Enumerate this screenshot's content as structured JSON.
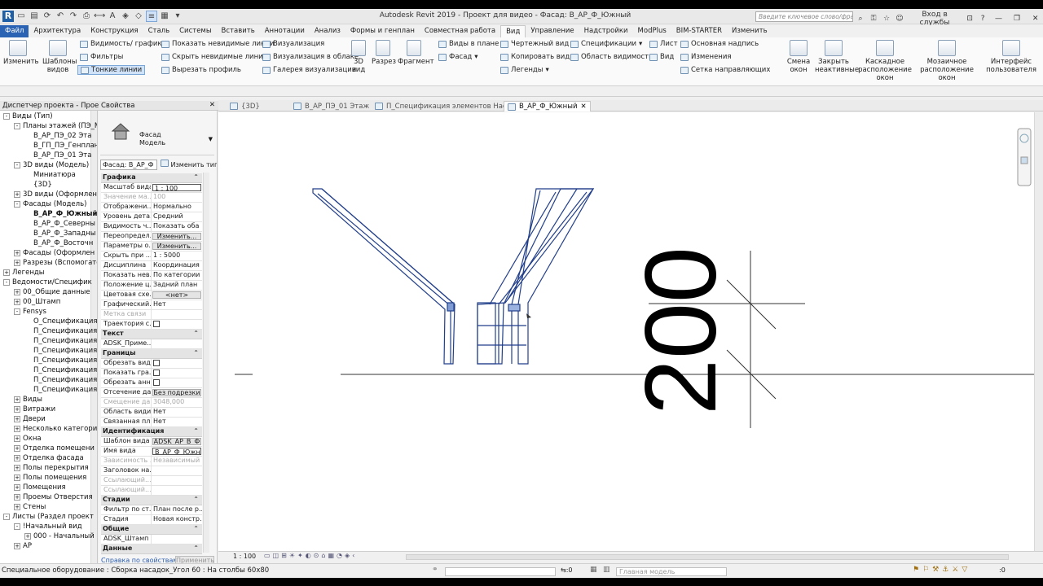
{
  "titlebar": {
    "title": "Autodesk Revit 2019 - Проект для видео - Фасад: В_АР_Ф_Южный",
    "search_placeholder": "Введите ключевое слово/фразу",
    "login": "Вход в службы",
    "logo": "R"
  },
  "menu": [
    "Файл",
    "Архитектура",
    "Конструкция",
    "Сталь",
    "Системы",
    "Вставить",
    "Аннотации",
    "Анализ",
    "Формы и генплан",
    "Совместная работа",
    "Вид",
    "Управление",
    "Надстройки",
    "ModPlus",
    "BIM-STARTER",
    "Изменить"
  ],
  "ribbon": {
    "modify": "Изменить",
    "templates": "Шаблоны видов",
    "vis_graphics": "Видимость/ графика",
    "filters": "Фильтры",
    "thin_lines": "Тонкие линии",
    "show_hidden": "Показать невидимые линии",
    "hide_hidden": "Скрыть невидимые линии",
    "render_profile": "Вырезать профиль",
    "visualization": "Визуализация",
    "cloud_render": "Визуализация  в облаке",
    "render_gallery": "Галерея  визуализации",
    "view3d": "3D вид",
    "section": "Разрез",
    "callout": "Фрагмент",
    "plan_views": "Виды в плане",
    "elevation": "Фасад",
    "drafting_view": "Чертежный вид",
    "duplicate_view": "Копировать вид",
    "legends": "Легенды",
    "schedules": "Спецификации",
    "scope_box": "Область видимости",
    "sheet": "Лист",
    "view": "Вид",
    "title_block": "Основная надпись",
    "revisions": "Изменения",
    "guide_grid": "Сетка направляющих",
    "switch_windows": "Смена окон",
    "close_inactive": "Закрыть неактивные",
    "cascade": "Каскадное расположение окон",
    "tile": "Мозаичное расположение окон",
    "ui": "Интерфейс пользователя"
  },
  "browser": {
    "header": "Диспетчер проекта - Прое...",
    "items": [
      {
        "label": "Виды (Тип)",
        "level": 0,
        "toggle": "-"
      },
      {
        "label": "Планы этажей (ПЭ_М",
        "level": 1,
        "toggle": "-"
      },
      {
        "label": "В_АР_ПЭ_02 Эта",
        "level": 2,
        "toggle": ""
      },
      {
        "label": "В_ГП_ПЭ_Генплан",
        "level": 2,
        "toggle": ""
      },
      {
        "label": "В_АР_ПЭ_01 Эта",
        "level": 2,
        "toggle": ""
      },
      {
        "label": "3D виды (Модель)",
        "level": 1,
        "toggle": "-"
      },
      {
        "label": "Миниатюра",
        "level": 2,
        "toggle": ""
      },
      {
        "label": "{3D}",
        "level": 2,
        "toggle": ""
      },
      {
        "label": "3D виды (Оформлен",
        "level": 1,
        "toggle": "+"
      },
      {
        "label": "Фасады (Модель)",
        "level": 1,
        "toggle": "-"
      },
      {
        "label": "В_АР_Ф_Южный",
        "level": 2,
        "toggle": "",
        "bold": true
      },
      {
        "label": "В_АР_Ф_Северны",
        "level": 2,
        "toggle": ""
      },
      {
        "label": "В_АР_Ф_Западны",
        "level": 2,
        "toggle": ""
      },
      {
        "label": "В_АР_Ф_Восточн",
        "level": 2,
        "toggle": ""
      },
      {
        "label": "Фасады (Оформлен",
        "level": 1,
        "toggle": "+"
      },
      {
        "label": "Разрезы (Вспомогате",
        "level": 1,
        "toggle": "+"
      },
      {
        "label": "Легенды",
        "level": 0,
        "toggle": "+"
      },
      {
        "label": "Ведомости/Специфик",
        "level": 0,
        "toggle": "-"
      },
      {
        "label": "00_Общие данные",
        "level": 1,
        "toggle": "+"
      },
      {
        "label": "00_Штамп",
        "level": 1,
        "toggle": "+"
      },
      {
        "label": "Fensys",
        "level": 1,
        "toggle": "-"
      },
      {
        "label": "О_Спецификация",
        "level": 2,
        "toggle": ""
      },
      {
        "label": "П_Спецификация",
        "level": 2,
        "toggle": ""
      },
      {
        "label": "П_Спецификация",
        "level": 2,
        "toggle": ""
      },
      {
        "label": "П_Спецификация",
        "level": 2,
        "toggle": ""
      },
      {
        "label": "П_Спецификация",
        "level": 2,
        "toggle": ""
      },
      {
        "label": "П_Спецификация",
        "level": 2,
        "toggle": ""
      },
      {
        "label": "П_Спецификация",
        "level": 2,
        "toggle": ""
      },
      {
        "label": "П_Спецификация",
        "level": 2,
        "toggle": ""
      },
      {
        "label": "Виды",
        "level": 1,
        "toggle": "+"
      },
      {
        "label": "Витражи",
        "level": 1,
        "toggle": "+"
      },
      {
        "label": "Двери",
        "level": 1,
        "toggle": "+"
      },
      {
        "label": "Несколько категори",
        "level": 1,
        "toggle": "+"
      },
      {
        "label": "Окна",
        "level": 1,
        "toggle": "+"
      },
      {
        "label": "Отделка помещени",
        "level": 1,
        "toggle": "+"
      },
      {
        "label": "Отделка фасада",
        "level": 1,
        "toggle": "+"
      },
      {
        "label": "Полы перекрытия",
        "level": 1,
        "toggle": "+"
      },
      {
        "label": "Полы помещения",
        "level": 1,
        "toggle": "+"
      },
      {
        "label": "Помещения",
        "level": 1,
        "toggle": "+"
      },
      {
        "label": "Проемы Отверстия",
        "level": 1,
        "toggle": "+"
      },
      {
        "label": "Стены",
        "level": 1,
        "toggle": "+"
      },
      {
        "label": "Листы (Раздел проект",
        "level": 0,
        "toggle": "-"
      },
      {
        "label": "!Начальный вид",
        "level": 1,
        "toggle": "-"
      },
      {
        "label": "000 - Начальный",
        "level": 2,
        "toggle": "+"
      },
      {
        "label": "АР",
        "level": 1,
        "toggle": "+"
      }
    ]
  },
  "props": {
    "header": "Свойства",
    "type_family": "Фасад",
    "type_name": "Модель",
    "instance_select": "Фасад: В_АР_Ф",
    "edit_type": "Изменить тип",
    "help_link": "Справка по свойствам",
    "apply": "Применить",
    "rows": [
      {
        "sec": "Графика"
      },
      {
        "k": "Масштаб вида",
        "v": "1 : 100",
        "input": true
      },
      {
        "k": "Значение ма...",
        "v": "100",
        "dis": true
      },
      {
        "k": "Отображени...",
        "v": "Нормально"
      },
      {
        "k": "Уровень дета...",
        "v": "Средний"
      },
      {
        "k": "Видимость ч...",
        "v": "Показать оба"
      },
      {
        "k": "Переопредел...",
        "v": "Изменить...",
        "btn": true
      },
      {
        "k": "Параметры о...",
        "v": "Изменить...",
        "btn": true
      },
      {
        "k": "Скрыть при ...",
        "v": "1 : 5000"
      },
      {
        "k": "Дисциплина",
        "v": "Координация"
      },
      {
        "k": "Показать нев...",
        "v": "По категории"
      },
      {
        "k": "Положение ц...",
        "v": "Задний план"
      },
      {
        "k": "Цветовая схе...",
        "v": "<нет>",
        "btn": true
      },
      {
        "k": "Графический...",
        "v": "Нет"
      },
      {
        "k": "Метка связи",
        "v": "",
        "dis": true
      },
      {
        "k": "Траектория с...",
        "v": "",
        "chk": true
      },
      {
        "sec": "Текст"
      },
      {
        "k": "ADSK_Приме...",
        "v": ""
      },
      {
        "sec": "Границы"
      },
      {
        "k": "Обрезать вид",
        "v": "",
        "chk": true
      },
      {
        "k": "Показать гра...",
        "v": "",
        "chk": true
      },
      {
        "k": "Обрезать анн...",
        "v": "",
        "chk": true
      },
      {
        "k": "Отсечение да...",
        "v": "Без подрезки",
        "btn": true
      },
      {
        "k": "Смещение да...",
        "v": "3048,000",
        "dis": true
      },
      {
        "k": "Область види...",
        "v": "Нет"
      },
      {
        "k": "Связанная пл...",
        "v": "Нет"
      },
      {
        "sec": "Идентификация"
      },
      {
        "k": "Шаблон вида",
        "v": "ADSK_AP_B_Ф",
        "btn": true
      },
      {
        "k": "Имя вида",
        "v": "В_АР_Ф_Южный",
        "input": true
      },
      {
        "k": "Зависимость ...",
        "v": "Независимый",
        "dis": true
      },
      {
        "k": "Заголовок на...",
        "v": ""
      },
      {
        "k": "Ссылающий...",
        "v": "",
        "dis": true
      },
      {
        "k": "Ссылающий...",
        "v": "",
        "dis": true
      },
      {
        "sec": "Стадии"
      },
      {
        "k": "Фильтр по ст...",
        "v": "План после р..."
      },
      {
        "k": "Стадия",
        "v": "Новая констр..."
      },
      {
        "sec": "Общие"
      },
      {
        "k": "ADSK_Штамп ...",
        "v": ""
      },
      {
        "sec": "Данные"
      }
    ]
  },
  "tabs": [
    {
      "label": "{3D}",
      "icon": "3d-view-icon",
      "active": false
    },
    {
      "label": "В_АР_ПЭ_01 Этаж",
      "icon": "floor-plan-icon",
      "active": false
    },
    {
      "label": "П_Спецификация элементов Наса...",
      "icon": "schedule-icon",
      "active": false
    },
    {
      "label": "В_АР_Ф_Южный",
      "icon": "elevation-icon",
      "active": true
    }
  ],
  "canvas": {
    "dimension": "200"
  },
  "viewbar": {
    "scale": "1 : 100"
  },
  "status": {
    "text": "Специальное оборудование : Сборка насадок_Угол 60 : На столбы 60x80",
    "workset": "",
    "model": "Главная модель",
    "sel_count": ":0",
    "filter": ":0"
  }
}
